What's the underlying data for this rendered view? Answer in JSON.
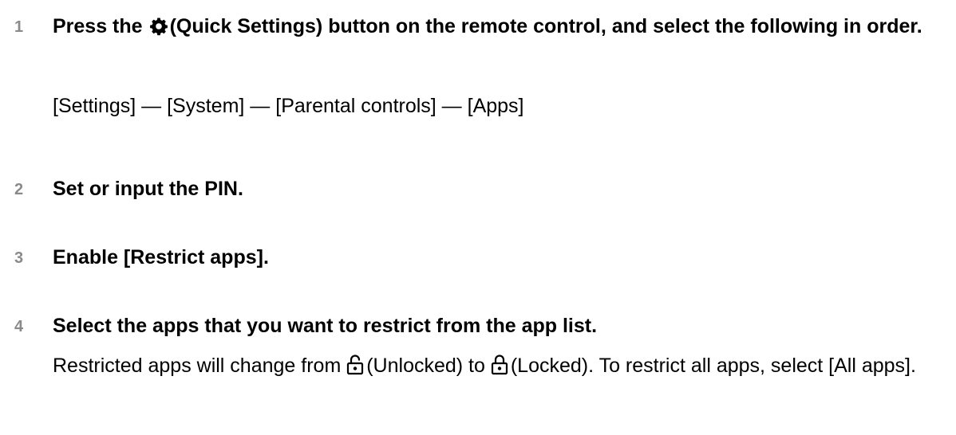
{
  "steps": [
    {
      "number": "1",
      "title_before_icon": "Press the",
      "title_icon": "gear-icon",
      "title_after_icon": "(Quick Settings) button on the remote control, and select the following in order.",
      "body": "[Settings] — [System] — [Parental controls] — [Apps]"
    },
    {
      "number": "2",
      "title": "Set or input the PIN."
    },
    {
      "number": "3",
      "title": "Enable [Restrict apps]."
    },
    {
      "number": "4",
      "title": "Select the apps that you want to restrict from the app list.",
      "body_part1": "Restricted apps will change from",
      "unlocked_icon": "unlocked-padlock-icon",
      "body_part2": "(Unlocked) to",
      "locked_icon": "locked-padlock-icon",
      "body_part3": "(Locked). To restrict all apps, select [All apps]."
    }
  ],
  "colors": {
    "step_number": "#8a8a8a",
    "text": "#000000",
    "background": "#ffffff"
  }
}
